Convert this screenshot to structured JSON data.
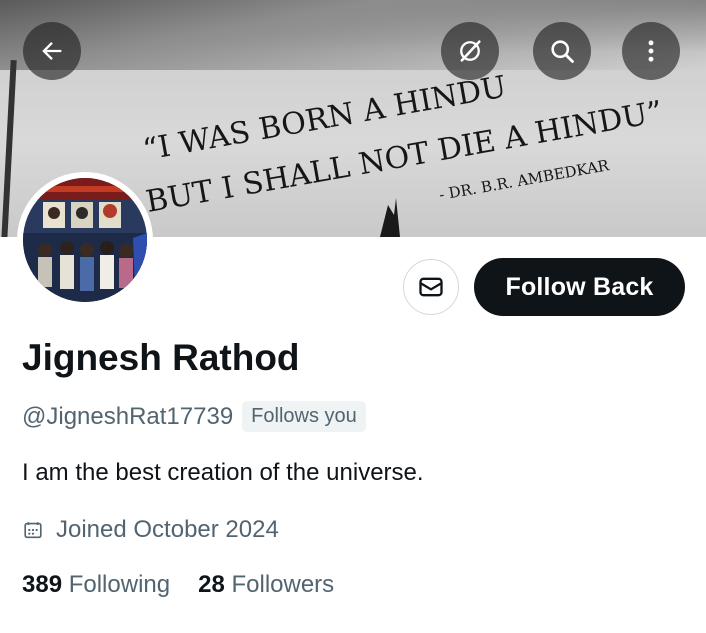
{
  "header": {
    "banner_quote_line1": "“I WAS BORN A HINDU",
    "banner_quote_line2": "BUT I SHALL NOT DIE A HINDU”",
    "banner_quote_author": "- DR. B.R. AMBEDKAR",
    "back_icon": "arrow-left-icon",
    "grok_icon": "grok-icon",
    "search_icon": "search-icon",
    "more_icon": "more-vertical-icon"
  },
  "profile": {
    "name": "Jignesh Rathod",
    "handle": "@JigneshRat17739",
    "follows_you": "Follows you",
    "bio": "I am the best creation of the universe.",
    "joined": "Joined October 2024",
    "following_count": "389",
    "following_label": "Following",
    "followers_count": "28",
    "followers_label": "Followers"
  },
  "actions": {
    "follow_back": "Follow Back",
    "message_icon": "mail-icon"
  },
  "colors": {
    "primary_text": "#0f1419",
    "secondary_text": "#536471",
    "button_bg": "#0f1419"
  }
}
